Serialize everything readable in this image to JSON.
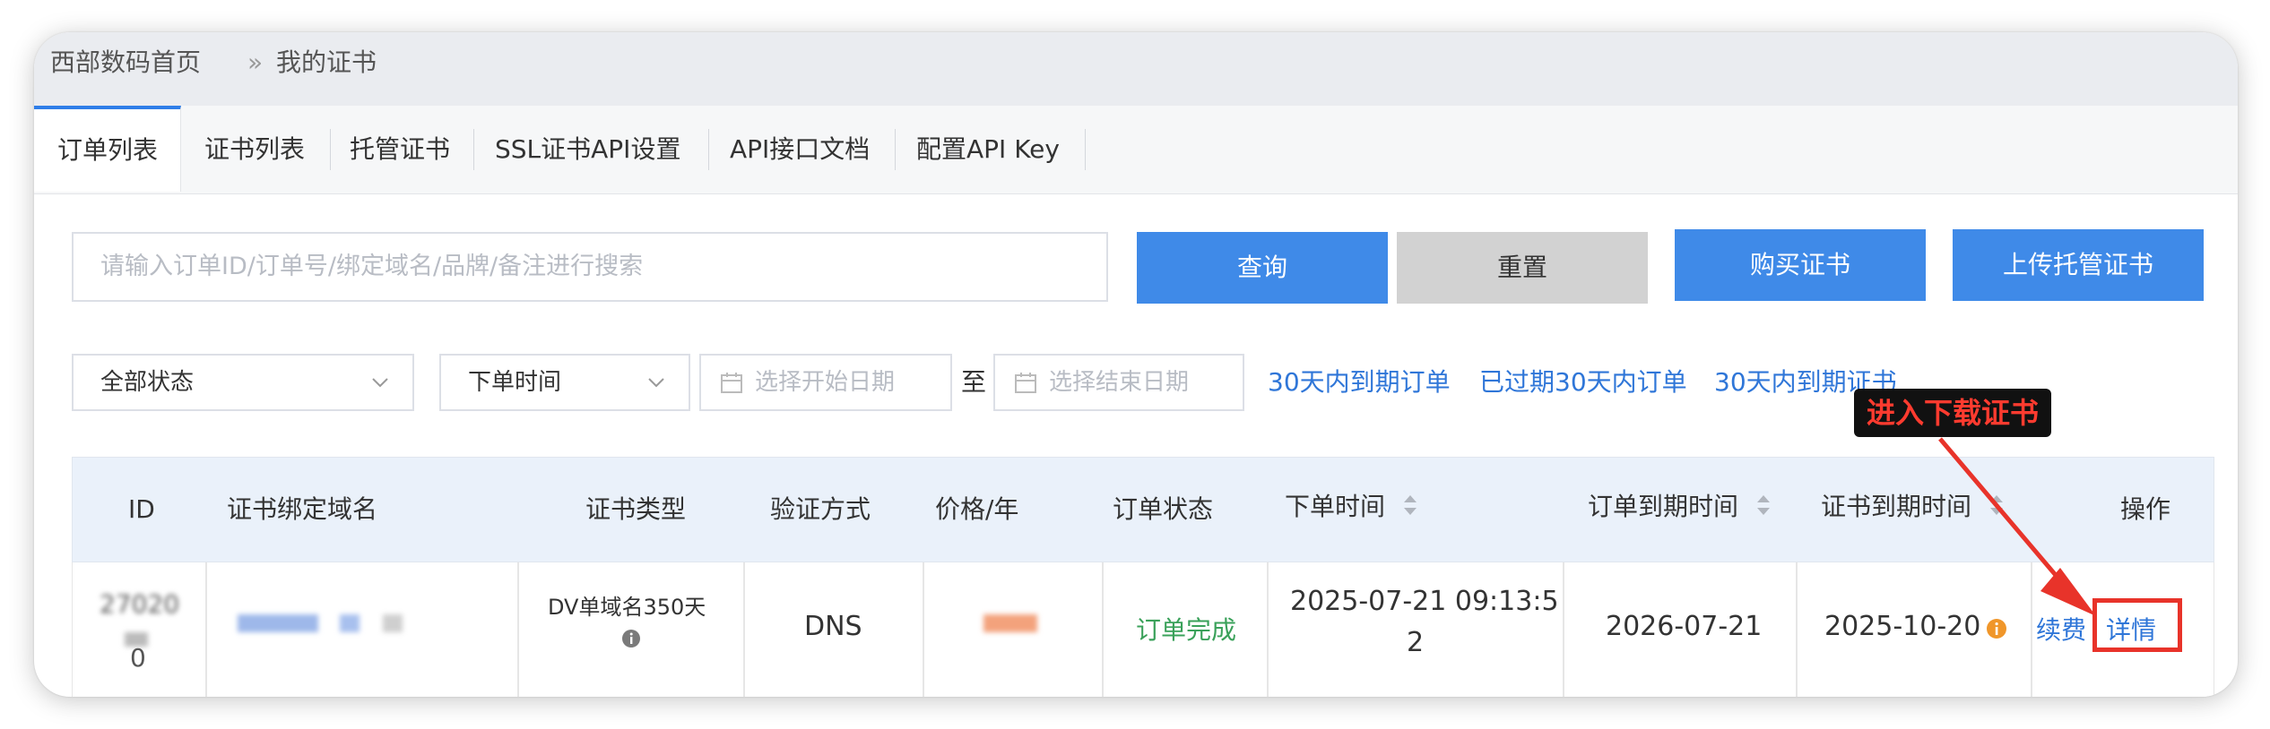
{
  "breadcrumb": {
    "home": "西部数码首页",
    "separator": "»",
    "current": "我的证书"
  },
  "tabs": [
    {
      "label": "订单列表",
      "active": true
    },
    {
      "label": "证书列表",
      "active": false
    },
    {
      "label": "托管证书",
      "active": false
    },
    {
      "label": "SSL证书API设置",
      "active": false
    },
    {
      "label": "API接口文档",
      "active": false
    },
    {
      "label": "配置API Key",
      "active": false
    }
  ],
  "search": {
    "placeholder": "请输入订单ID/订单号/绑定域名/品牌/备注进行搜索",
    "query_label": "查询",
    "reset_label": "重置"
  },
  "actions": {
    "buy_label": "购买证书",
    "upload_label": "上传托管证书"
  },
  "filters": {
    "status_value": "全部状态",
    "time_field_value": "下单时间",
    "start_date_placeholder": "选择开始日期",
    "range_separator": "至",
    "end_date_placeholder": "选择结束日期",
    "quick_links": [
      "30天内到期订单",
      "已过期30天内订单",
      "30天内到期证书"
    ]
  },
  "table": {
    "headers": {
      "id": "ID",
      "domain": "证书绑定域名",
      "type": "证书类型",
      "verify": "验证方式",
      "price": "价格/年",
      "status": "订单状态",
      "order_time": "下单时间",
      "order_expire": "订单到期时间",
      "cert_expire": "证书到期时间",
      "ops": "操作"
    },
    "rows": [
      {
        "id_line1": "27020",
        "id_line3": "0",
        "type": "DV单域名350天",
        "verify": "DNS",
        "status": "订单完成",
        "order_time_line1": "2025-07-21 09:13:5",
        "order_time_line2": "2",
        "order_expire": "2026-07-21",
        "cert_expire": "2025-10-20",
        "renew_label": "续费",
        "detail_label": "详情"
      }
    ]
  },
  "annotation": {
    "label": "进入下载证书"
  },
  "colors": {
    "primary": "#3f8ae8",
    "link": "#2f76d8",
    "success": "#3aa15a",
    "warning": "#f0962a",
    "annotation_red": "#e8332a"
  }
}
